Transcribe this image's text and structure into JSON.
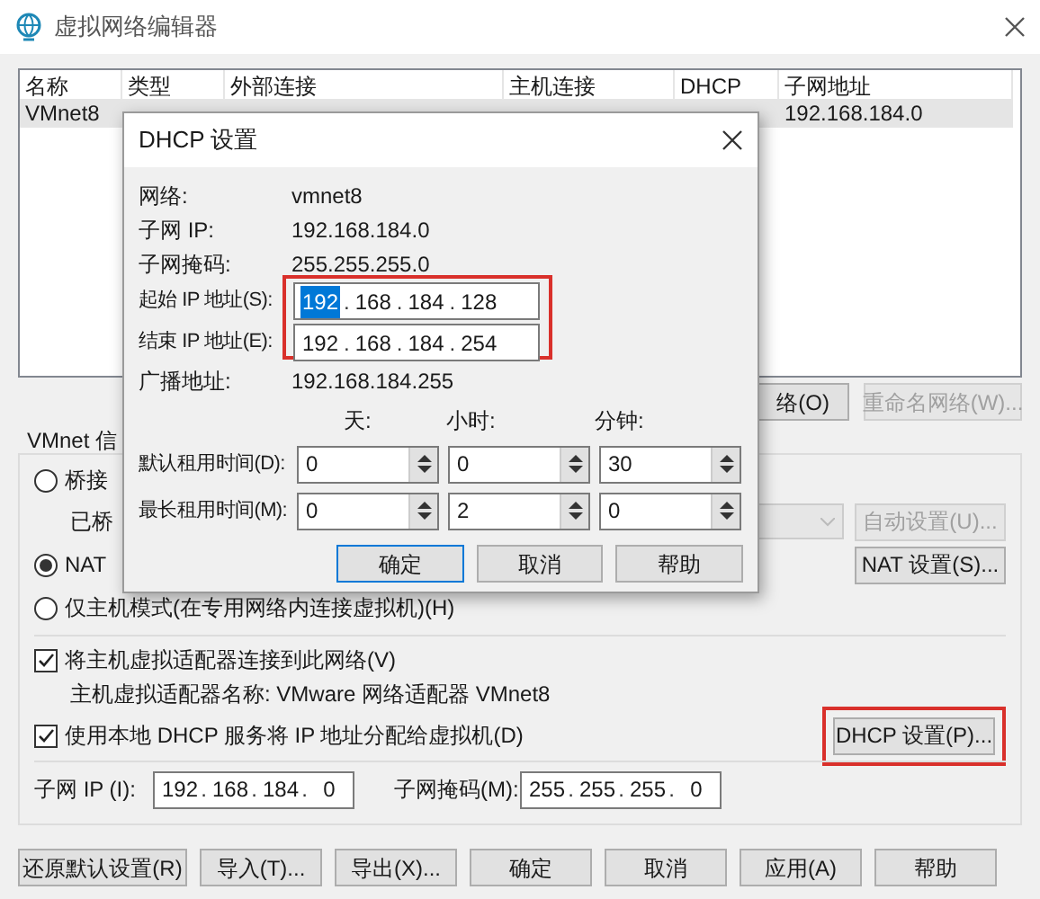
{
  "window": {
    "title": "虚拟网络编辑器"
  },
  "network_table": {
    "columns": [
      "名称",
      "类型",
      "外部连接",
      "主机连接",
      "DHCP",
      "子网地址"
    ],
    "rows": [
      {
        "selected": true,
        "cells": [
          "VMnet8",
          "",
          "",
          "",
          "",
          "192.168.184.0"
        ]
      }
    ]
  },
  "network_buttons": [
    {
      "label": "络(O)",
      "disabled": false
    },
    {
      "label": "重命名网络(W)...",
      "disabled": true
    }
  ],
  "vmnet_info": {
    "title": "VMnet 信",
    "modes": [
      {
        "label": "桥接",
        "selected": false
      },
      {
        "label": "NAT",
        "selected": true
      },
      {
        "label": "仅主机模式(在专用网络内连接虚拟机)(H)",
        "selected": false
      }
    ],
    "bridged_to_label": "已桥",
    "auto_button": {
      "label": "自动设置(U)...",
      "disabled": true
    },
    "nat_button": {
      "label": "NAT 设置(S)...",
      "disabled": false
    },
    "options": [
      {
        "label": "将主机虚拟适配器连接到此网络(V)",
        "checked": true,
        "note": "主机虚拟适配器名称: VMware 网络适配器 VMnet8"
      },
      {
        "label": "使用本地 DHCP 服务将 IP 地址分配给虚拟机(D)",
        "checked": true,
        "button": {
          "label": "DHCP 设置(P)...",
          "highlighted": true
        }
      }
    ],
    "subnet_ip": {
      "label": "子网 IP (I):",
      "separator": ".",
      "octets": [
        "192",
        "168",
        "184",
        "0"
      ]
    },
    "subnet_mask": {
      "label": "子网掩码(M):",
      "separator": ".",
      "octets": [
        "255",
        "255",
        "255",
        "0"
      ]
    }
  },
  "footer_buttons": [
    "还原默认设置(R)",
    "导入(T)...",
    "导出(X)...",
    "确定",
    "取消",
    "应用(A)",
    "帮助"
  ],
  "dhcp_dialog": {
    "title": "DHCP 设置",
    "info": [
      {
        "label": "网络:",
        "value": "vmnet8"
      },
      {
        "label": "子网 IP:",
        "value": "192.168.184.0"
      },
      {
        "label": "子网掩码:",
        "value": "255.255.255.0"
      }
    ],
    "range": {
      "highlighted": true,
      "fields": [
        {
          "label": "起始 IP 地址(S):",
          "separator": ".",
          "octets": [
            {
              "text": "192",
              "selected": true
            },
            {
              "text": "168",
              "selected": false
            },
            {
              "text": "184",
              "selected": false
            },
            {
              "text": "128",
              "selected": false
            }
          ]
        },
        {
          "label": "结束 IP 地址(E):",
          "separator": ".",
          "octets": [
            {
              "text": "192",
              "selected": false
            },
            {
              "text": "168",
              "selected": false
            },
            {
              "text": "184",
              "selected": false
            },
            {
              "text": "254",
              "selected": false
            }
          ]
        }
      ]
    },
    "broadcast": {
      "label": "广播地址:",
      "value": "192.168.184.255"
    },
    "lease": {
      "units": [
        "天:",
        "小时:",
        "分钟:"
      ],
      "rows": [
        {
          "label": "默认租用时间(D):",
          "values": [
            "0",
            "0",
            "30"
          ]
        },
        {
          "label": "最长租用时间(M):",
          "values": [
            "0",
            "2",
            "0"
          ]
        }
      ]
    },
    "buttons": [
      {
        "label": "确定",
        "default": true
      },
      {
        "label": "取消",
        "default": false
      },
      {
        "label": "帮助",
        "default": false
      }
    ]
  }
}
